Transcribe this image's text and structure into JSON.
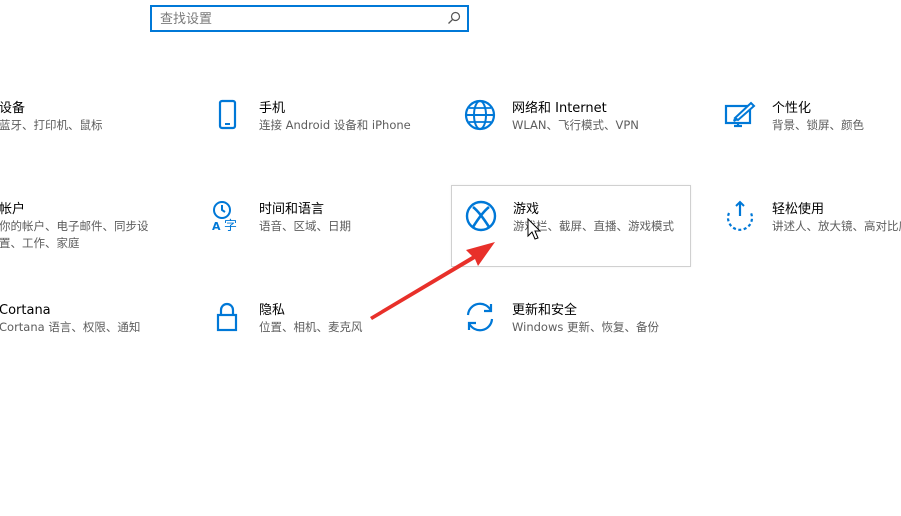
{
  "search": {
    "placeholder": "查找设置"
  },
  "accent_color": "#0078d7",
  "arrow_color": "#e8302a",
  "tiles": [
    {
      "title": "设备",
      "desc": "蓝牙、打印机、鼠标",
      "icon": "devices-icon"
    },
    {
      "title": "手机",
      "desc": "连接 Android 设备和 iPhone",
      "icon": "phone-icon"
    },
    {
      "title": "网络和 Internet",
      "desc": "WLAN、飞行模式、VPN",
      "icon": "globe-icon"
    },
    {
      "title": "个性化",
      "desc": "背景、锁屏、颜色",
      "icon": "personalization-icon"
    },
    {
      "title": "帐户",
      "desc": "你的帐户、电子邮件、同步设",
      "desc2": "置、工作、家庭",
      "icon": "account-icon"
    },
    {
      "title": "时间和语言",
      "desc": "语音、区域、日期",
      "icon": "time-language-icon"
    },
    {
      "title": "游戏",
      "desc": "游戏栏、截屏、直播、游戏模式",
      "icon": "xbox-icon"
    },
    {
      "title": "轻松使用",
      "desc": "讲述人、放大镜、高对比度",
      "icon": "ease-of-access-icon"
    },
    {
      "title": "Cortana",
      "desc": "Cortana 语言、权限、通知",
      "icon": "cortana-icon"
    },
    {
      "title": "隐私",
      "desc": "位置、相机、麦克风",
      "icon": "lock-icon"
    },
    {
      "title": "更新和安全",
      "desc": "Windows 更新、恢复、备份",
      "icon": "update-icon"
    }
  ]
}
